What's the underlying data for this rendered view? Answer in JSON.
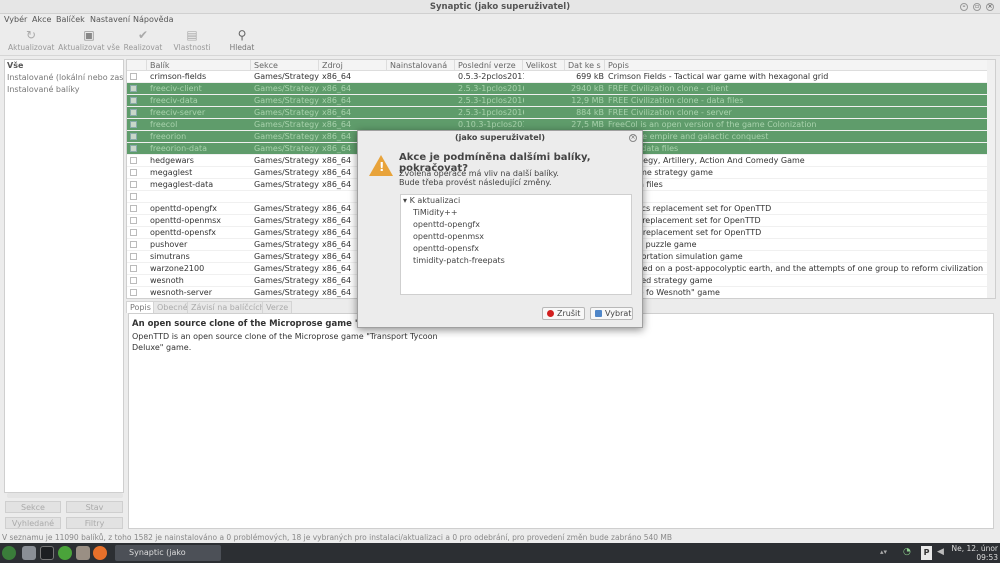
{
  "window": {
    "title": "Synaptic (jako superuživatel)"
  },
  "menu": [
    "Vybér",
    "Akce",
    "Balíček",
    "Nastavení",
    "Nápověda"
  ],
  "toolbar": [
    {
      "label": "Aktualizovat",
      "icon": "refresh-icon"
    },
    {
      "label": "Aktualizovat vše",
      "icon": "upgrade-icon"
    },
    {
      "label": "Realizovat",
      "icon": "apply-icon"
    },
    {
      "label": "Vlastnosti",
      "icon": "properties-icon"
    },
    {
      "label": "Hledat",
      "icon": "search-icon"
    }
  ],
  "filters": [
    "Vše",
    "Instalované (lokální nebo zastaralé)",
    "Instalované balíky"
  ],
  "left_buttons": [
    "Sekce",
    "Stav",
    "Vyhledané",
    "Filtry"
  ],
  "columns": [
    "Balík",
    "Sekce",
    "Zdroj",
    "Nainstalovaná",
    "Poslední verze",
    "Velikost",
    "Dat ke s",
    "Popis"
  ],
  "rows": [
    {
      "name": "crimson-fields",
      "section": "Games/Strategy",
      "source": "x86_64",
      "installed": "",
      "latest": "0.5.3-2pclos2011",
      "size": "",
      "dl": "699 kB",
      "desc": "Crimson Fields - Tactical war game with hexagonal grid",
      "sel": false
    },
    {
      "name": "freeciv-client",
      "section": "Games/Strategy",
      "source": "x86_64",
      "installed": "",
      "latest": "2.5.3-1pclos2016",
      "size": "",
      "dl": "2940 kB",
      "desc": "FREE Civilization clone - client",
      "sel": true
    },
    {
      "name": "freeciv-data",
      "section": "Games/Strategy",
      "source": "x86_64",
      "installed": "",
      "latest": "2.5.3-1pclos2016",
      "size": "",
      "dl": "12,9 MB",
      "desc": "FREE Civilization clone - data files",
      "sel": true
    },
    {
      "name": "freeciv-server",
      "section": "Games/Strategy",
      "source": "x86_64",
      "installed": "",
      "latest": "2.5.3-1pclos2016",
      "size": "",
      "dl": "884 kB",
      "desc": "FREE Civilization clone - server",
      "sel": true
    },
    {
      "name": "freecol",
      "section": "Games/Strategy",
      "source": "x86_64",
      "installed": "",
      "latest": "0.10.3-1pclos2016",
      "size": "",
      "dl": "27,5 MB",
      "desc": "FreeCol is an open version of the game Colonization",
      "sel": true
    },
    {
      "name": "freeorion",
      "section": "Games/Strategy",
      "source": "x86_64",
      "installed": "",
      "latest": "",
      "size": "",
      "dl": "",
      "desc": "…d space empire and galactic conquest",
      "sel": true
    },
    {
      "name": "freeorion-data",
      "section": "Games/Strategy",
      "source": "x86_64",
      "installed": "",
      "latest": "",
      "size": "",
      "dl": "",
      "desc": "…game data files",
      "sel": true
    },
    {
      "name": "hedgewars",
      "section": "Games/Strategy",
      "source": "x86_64",
      "installed": "",
      "latest": "",
      "size": "",
      "dl": "",
      "desc": "…d Strategy, Artillery, Action And Comedy Game",
      "sel": false
    },
    {
      "name": "megaglest",
      "section": "Games/Strategy",
      "source": "x86_64",
      "installed": "",
      "latest": "",
      "size": "",
      "dl": "",
      "desc": "…real time strategy game",
      "sel": false
    },
    {
      "name": "megaglest-data",
      "section": "Games/Strategy",
      "source": "x86_64",
      "installed": "",
      "latest": "",
      "size": "",
      "dl": "",
      "desc": "…st data files",
      "sel": false
    },
    {
      "name": "",
      "section": "",
      "source": "",
      "installed": "",
      "latest": "",
      "size": "",
      "dl": "",
      "desc": "",
      "sel": false
    },
    {
      "name": "openttd-opengfx",
      "section": "Games/Strategy",
      "source": "x86_64",
      "installed": "",
      "latest": "",
      "size": "",
      "dl": "",
      "desc": "…graphics replacement set for OpenTTD",
      "sel": false
    },
    {
      "name": "openttd-openmsx",
      "section": "Games/Strategy",
      "source": "x86_64",
      "installed": "",
      "latest": "",
      "size": "",
      "dl": "",
      "desc": "…music replacement set for OpenTTD",
      "sel": false
    },
    {
      "name": "openttd-opensfx",
      "section": "Games/Strategy",
      "source": "x86_64",
      "installed": "",
      "latest": "",
      "size": "",
      "dl": "",
      "desc": "…sound replacement set for OpenTTD",
      "sel": false
    },
    {
      "name": "pushover",
      "section": "Games/Strategy",
      "source": "x86_64",
      "installed": "",
      "latest": "",
      "size": "",
      "dl": "",
      "desc": "…s a fun puzzle game",
      "sel": false
    },
    {
      "name": "simutrans",
      "section": "Games/Strategy",
      "source": "x86_64",
      "installed": "",
      "latest": "",
      "size": "",
      "dl": "",
      "desc": "…transportation simulation game",
      "sel": false
    },
    {
      "name": "warzone2100",
      "section": "Games/Strategy",
      "source": "x86_64",
      "installed": "",
      "latest": "",
      "size": "",
      "dl": "",
      "desc": "…ne based on a post-appocolyptic earth, and the attempts of one group to reform civilization",
      "sel": false
    },
    {
      "name": "wesnoth",
      "section": "Games/Strategy",
      "source": "x86_64",
      "installed": "",
      "latest": "",
      "size": "",
      "dl": "",
      "desc": "…rn-based strategy game",
      "sel": false
    },
    {
      "name": "wesnoth-server",
      "section": "Games/Strategy",
      "source": "x86_64",
      "installed": "",
      "latest": "",
      "size": "",
      "dl": "",
      "desc": "…\"Battle fo Wesnoth\" game",
      "sel": false
    }
  ],
  "tabs": [
    "Popis",
    "Obecné",
    "Závisí na balíčcích",
    "Verze"
  ],
  "description": {
    "title": "An open source clone of the Microprose game \"Tran",
    "text_line1": "OpenTTD is an open source clone of the Microprose game \"Transport Tycoon",
    "text_line2": "Deluxe\" game."
  },
  "status": "V seznamu je 11090 balíků, z toho 1582 je nainstalováno a 0 problémových, 18 je vybraných pro instalaci/aktualizaci a 0 pro odebrání, pro provedení změn bude zabráno 540 MB",
  "dialog": {
    "title": "(jako superuživatel)",
    "heading": "Akce je podmíněna dalšími balíky, pokračovat?",
    "line1": "Zvolená operace má vliv na další balíky.",
    "line2": "Bude třeba provést následující změny.",
    "tree_root": "K aktualizaci",
    "tree_items": [
      "TiMidity++",
      "openttd-opengfx",
      "openttd-openmsx",
      "openttd-opensfx",
      "timidity-patch-freepats"
    ],
    "cancel": "Zrušit",
    "ok": "Vybrat"
  },
  "taskbar": {
    "task": "Synaptic (jako superu...",
    "clock_line1": "Ne, 12. únor",
    "clock_line2": "09:53"
  }
}
